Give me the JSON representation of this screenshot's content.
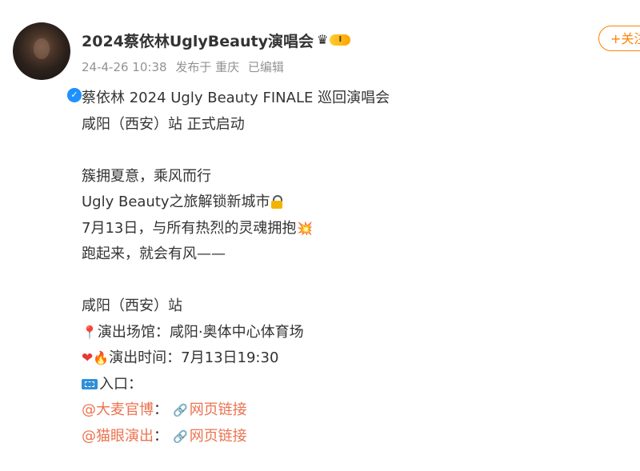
{
  "post": {
    "author": "2024蔡依林UglyBeauty演唱会",
    "vip_level": "I",
    "timestamp": "24-4-26 10:38",
    "source": "发布于 重庆",
    "edited": "已编辑",
    "follow_label": "+关注"
  },
  "content": {
    "line1": "蔡依林 2024 Ugly Beauty FINALE 巡回演唱会",
    "line2": "咸阳（西安）站 正式启动",
    "line3": "簇拥夏意，乘风而行",
    "line4": "Ugly Beauty之旅解锁新城市",
    "line5": "7月13日，与所有热烈的灵魂拥抱",
    "line6": "跑起来，就会有风——",
    "line7": "咸阳（西安）站",
    "venue": "演出场馆：咸阳·奥体中心体育场",
    "showtime": "演出时间：7月13日19:30",
    "entry": "入口：",
    "link1_user": "@大麦官博",
    "link1_text": "网页链接",
    "link2_user": "@猫眼演出",
    "link2_text": "网页链接",
    "sep": "："
  },
  "icons": {
    "lock": "lock-icon",
    "boom": "collision-icon",
    "pin": "round-pushpin-icon",
    "heart": "red-heart-icon",
    "fire": "fire-icon",
    "ticket": "ticket-icon",
    "chain": "link-icon",
    "crown": "crown-icon"
  },
  "colors": {
    "link": "#eb7350",
    "follow": "#ff8200",
    "meta": "#939393",
    "verified": "#1e90ff"
  }
}
